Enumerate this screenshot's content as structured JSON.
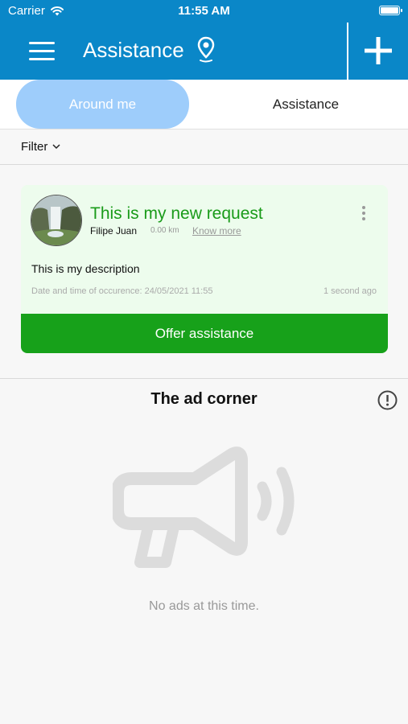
{
  "status_bar": {
    "carrier": "Carrier",
    "time": "11:55 AM"
  },
  "navbar": {
    "title": "Assistance"
  },
  "tabs": [
    {
      "label": "Around me"
    },
    {
      "label": "Assistance"
    }
  ],
  "filter": {
    "label": "Filter"
  },
  "card": {
    "title": "This is my new request",
    "author": "Filipe Juan",
    "distance": "0.00 km",
    "know_more": "Know more",
    "description": "This is my description",
    "date": "Date and time of occurence: 24/05/2021 11:55",
    "ago": "1 second ago",
    "action": "Offer assistance"
  },
  "ad_corner": {
    "title": "The ad corner",
    "empty_text": "No ads at this time."
  },
  "colors": {
    "primary": "#0a87c8",
    "tab_active": "#9ecdfb",
    "success": "#17a11a",
    "card_bg": "#edfced"
  }
}
